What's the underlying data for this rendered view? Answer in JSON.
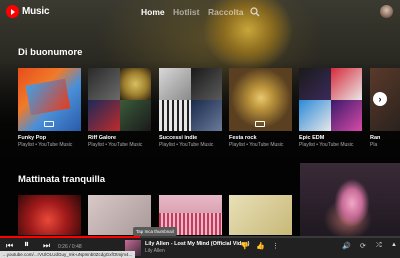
{
  "app": {
    "name": "Music"
  },
  "nav": {
    "tabs": [
      {
        "label": "Home"
      },
      {
        "label": "Hotlist"
      },
      {
        "label": "Raccolta"
      }
    ]
  },
  "shelf1": {
    "title": "Di buonumore",
    "items": [
      {
        "title": "Funky Pop",
        "subtitle": "Playlist • YouTube Music"
      },
      {
        "title": "Riff Galore",
        "subtitle": "Playlist • YouTube Music"
      },
      {
        "title": "Successi indie",
        "subtitle": "Playlist • YouTube Music"
      },
      {
        "title": "Festa rock",
        "subtitle": "Playlist • YouTube Music"
      },
      {
        "title": "Epic EDM",
        "subtitle": "Playlist • YouTube Music"
      },
      {
        "title": "Ran",
        "subtitle": "Pla"
      }
    ]
  },
  "shelf2": {
    "title": "Mattinata tranquilla"
  },
  "tooltip": "Tap Inca thumbnail",
  "player": {
    "time": "0:26 / 0:48",
    "progress": 0.35,
    "title": "Lily Allen - Lost My Mind (Official Video)",
    "artist": "Lily Allen"
  },
  "status_url": "...youtube.com/...rVUlOLUdGuy_mk-uNpInnb0ZcdgGxfOtmjm4...",
  "colors": {
    "accent": "#ff0000",
    "background": "#030303"
  }
}
